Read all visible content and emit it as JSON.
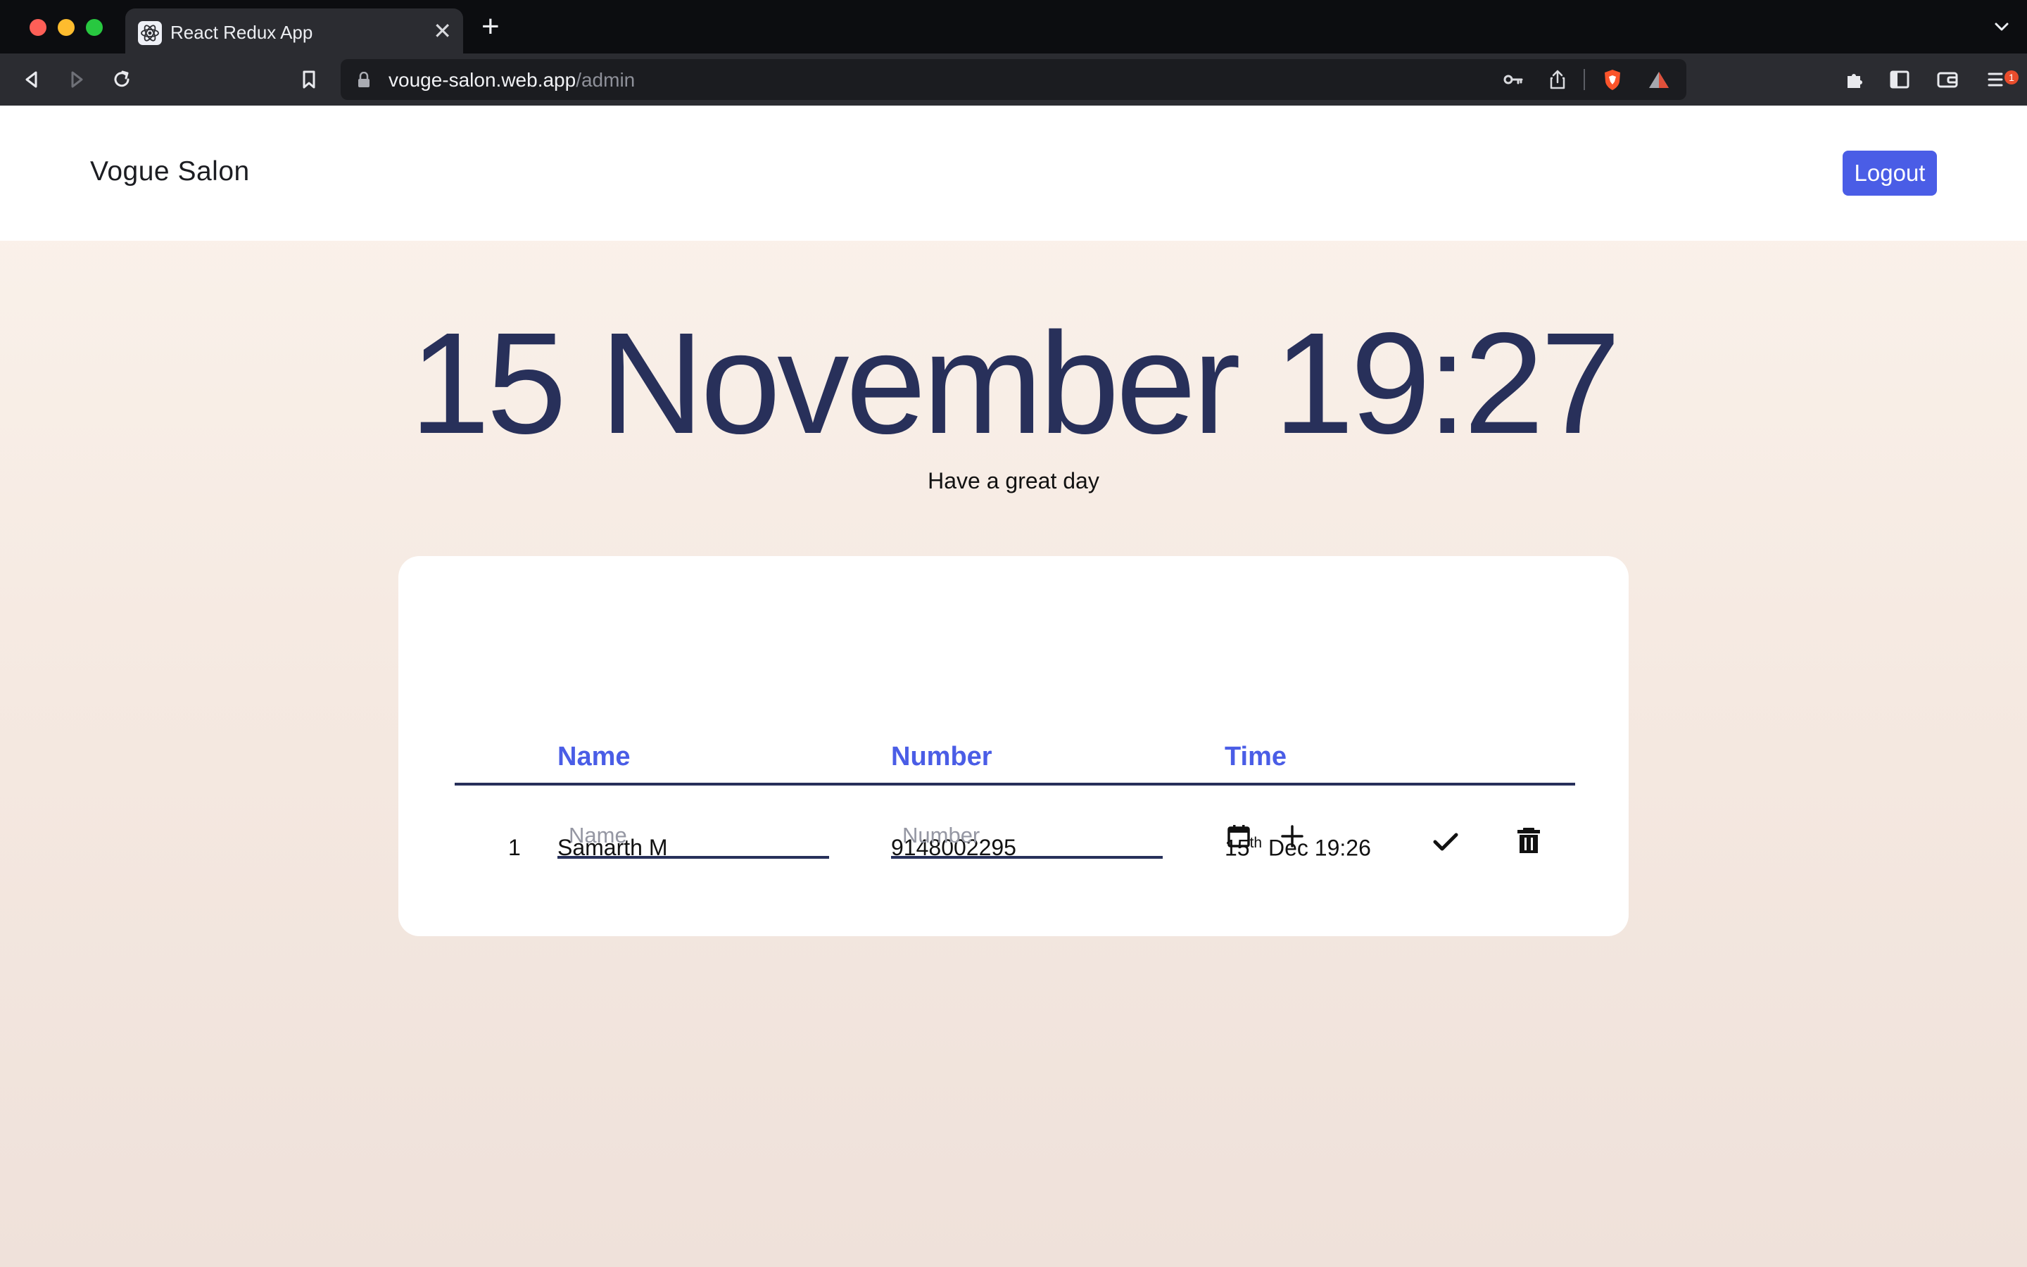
{
  "browser": {
    "tab_title": "React Redux App",
    "new_tab_label": "+",
    "close_label": "✕",
    "url_host": "vouge-salon.web.app",
    "url_path": "/admin",
    "shields_badge": "1"
  },
  "navbar": {
    "brand": "Vogue Salon",
    "logout_label": "Logout"
  },
  "hero": {
    "headline": "15 November 19:27",
    "greeting": "Have a great day"
  },
  "table": {
    "headers": {
      "name": "Name",
      "number": "Number",
      "time": "Time"
    },
    "rows": [
      {
        "index": "1",
        "name": "Samarth M",
        "number": "9148002295",
        "day": "15",
        "day_suffix": "th",
        "time_rest": " Dec 19:26"
      }
    ],
    "new_entry": {
      "name_placeholder": "Name",
      "number_placeholder": "Number"
    }
  },
  "icons": {
    "row_actions": [
      "check-icon",
      "trash-icon"
    ],
    "new_entry_actions": [
      "calendar-icon",
      "plus-icon"
    ]
  },
  "colors": {
    "accent": "#4a5de6",
    "headline": "#28305a",
    "divider": "#27305a"
  }
}
